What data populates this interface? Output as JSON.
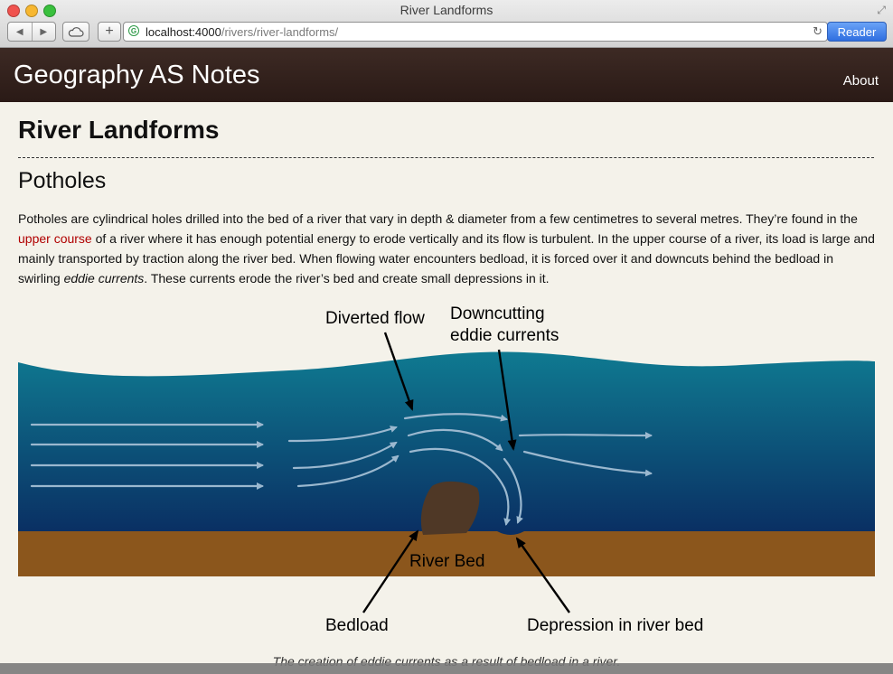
{
  "window": {
    "title": "River Landforms"
  },
  "toolbar": {
    "url_host": "localhost:4000",
    "url_path": "/rivers/river-landforms/",
    "reader_label": "Reader",
    "favicon_letter": "G"
  },
  "site": {
    "title": "Geography AS Notes",
    "nav": [
      {
        "label": "About"
      }
    ]
  },
  "page": {
    "title": "River Landforms",
    "section_title": "Potholes",
    "paragraph": {
      "before_link": "Potholes are cylindrical holes drilled into the bed of a river that vary in depth & diameter from a few centimetres to several metres. They’re found in the ",
      "link_text": "upper course",
      "after_link": " of a river where it has enough potential energy to erode vertically and its flow is turbulent. In the upper course of a river, its load is large and mainly transported by traction along the river bed. When flowing water encounters bedload, it is forced over it and downcuts behind the bedload in swirling ",
      "emphasis": "eddie currents",
      "after_emphasis": ". These currents erode the river’s bed and create small depressions in it."
    }
  },
  "diagram": {
    "labels": {
      "diverted_flow": "Diverted flow",
      "downcutting_line1": "Downcutting",
      "downcutting_line2": "eddie currents",
      "river_bed": "River Bed",
      "bedload": "Bedload",
      "depression": "Depression in river bed"
    },
    "colors": {
      "water_top": "#0f7a91",
      "water_bottom": "#0a2f63",
      "river_bed": "#8b561c",
      "bedload": "#4f3826",
      "flow_arrow": "#9bb8cf"
    },
    "caption": "The creation of eddie currents as a result of bedload in a river."
  }
}
